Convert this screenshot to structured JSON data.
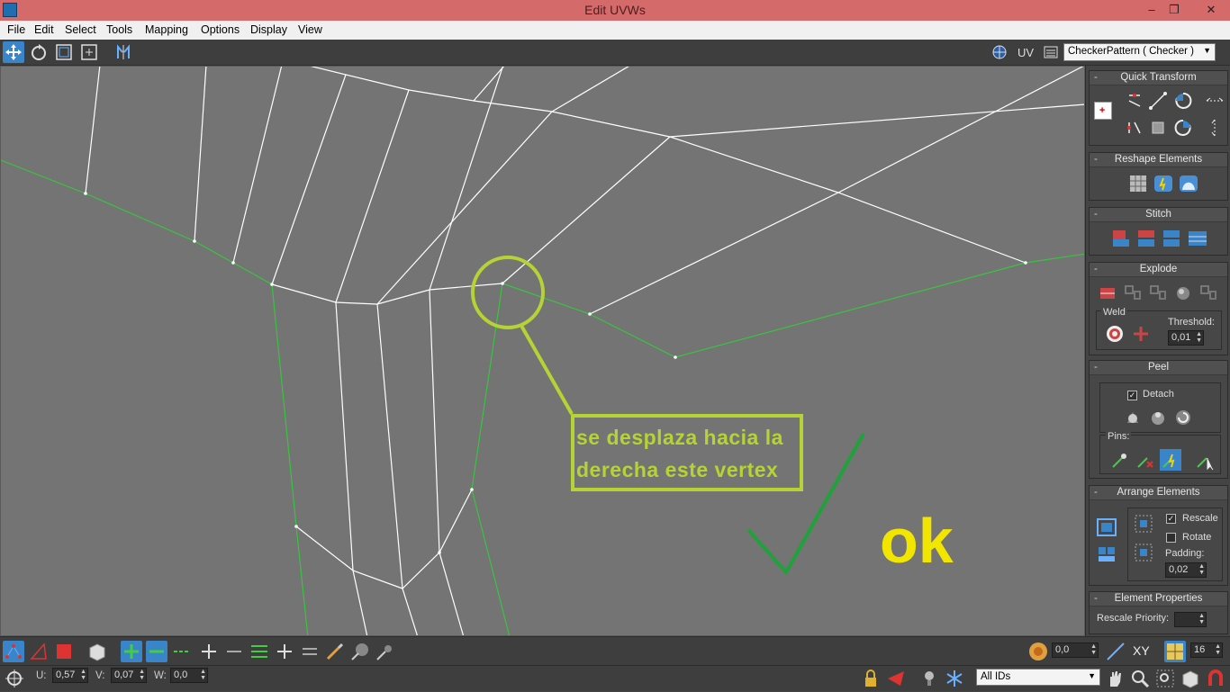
{
  "window": {
    "title": "Edit UVWs",
    "controls": [
      "–",
      "❐",
      "✕"
    ]
  },
  "menu": [
    "File",
    "Edit",
    "Select",
    "Tools",
    "Mapping",
    "Options",
    "Display",
    "View"
  ],
  "toolbar": {
    "uv_label": "UV",
    "texture_dropdown": "CheckerPattern  ( Checker )"
  },
  "annotations": {
    "callout_line1": "se desplaza hacia la",
    "callout_line2": "derecha este vertex",
    "ok": "ok",
    "colors": {
      "callout": "#b5d334",
      "ok": "#f2e600",
      "check": "#1fa23a",
      "seams": "#39c43f"
    }
  },
  "panel": {
    "quick_transform": "Quick Transform",
    "reshape_elements": "Reshape Elements",
    "stitch": "Stitch",
    "explode": "Explode",
    "weld": "Weld",
    "threshold_label": "Threshold:",
    "threshold_value": "0,01",
    "peel": "Peel",
    "detach": "Detach",
    "detach_checked": true,
    "pins": "Pins:",
    "arrange_elements": "Arrange Elements",
    "rescale": "Rescale",
    "rescale_checked": true,
    "rotate": "Rotate",
    "rotate_checked": false,
    "padding_label": "Padding:",
    "padding_value": "0,02",
    "element_properties": "Element Properties",
    "rescale_priority": "Rescale Priority:"
  },
  "statusbar": {
    "u_label": "U:",
    "u_value": "0,57",
    "v_label": "V:",
    "v_value": "0,07",
    "w_label": "W:",
    "w_value": "0,0",
    "angle_value": "0,0",
    "xy_label": "XY",
    "grid_value": "16",
    "ids_dropdown": "All IDs"
  },
  "minus": "-"
}
